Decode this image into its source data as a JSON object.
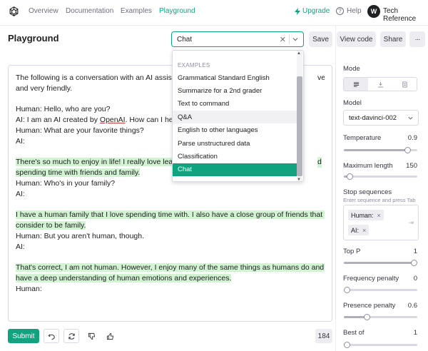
{
  "nav": {
    "links": [
      "Overview",
      "Documentation",
      "Examples",
      "Playground"
    ],
    "upgrade": "Upgrade",
    "help": "Help",
    "help_glyph": "?",
    "avatar_initial": "W",
    "org_name": "Tech Reference"
  },
  "header": {
    "title": "Playground",
    "preset_value": "Chat",
    "save": "Save",
    "view_code": "View code",
    "share": "Share",
    "more": "···"
  },
  "dropdown": {
    "heading": "EXAMPLES",
    "items": [
      "Grammatical Standard English",
      "Summarize for a 2nd grader",
      "Text to command",
      "Q&A",
      "English to other languages",
      "Parse unstructured data",
      "Classification",
      "Chat"
    ],
    "hover_index": 3,
    "selected_index": 7
  },
  "editor": {
    "lines": [
      {
        "text": "The following is a conversation with an AI assist",
        "tail": "ver,",
        "hl": false
      },
      {
        "text": "and very friendly.",
        "hl": false
      },
      {
        "text": "",
        "hl": false
      },
      {
        "text": "Human: Hello, who are you?",
        "hl": false
      },
      {
        "pre": "AI: I am an AI created by ",
        "link": "OpenAI",
        "post": ". How can I he",
        "hl": false
      },
      {
        "text": "Human: What are your favorite things?",
        "hl": false
      },
      {
        "text": "AI:",
        "hl": false
      },
      {
        "text": "",
        "hl": false
      },
      {
        "text": "There's so much to enjoy in life! I really love learn",
        "tail": "d",
        "hl": true
      },
      {
        "text": "spending time with friends and family.",
        "hl": true
      },
      {
        "text": "Human: Who's in your family?",
        "hl": false
      },
      {
        "text": "AI:",
        "hl": false
      },
      {
        "text": "",
        "hl": false
      },
      {
        "text": "I have a human family that I love spending time with. I also have a close group of friends that I",
        "hl": true
      },
      {
        "text": " consider to be family.",
        "hl": true
      },
      {
        "text": "Human: But you aren't human, though.",
        "hl": false
      },
      {
        "text": "AI:",
        "hl": false
      },
      {
        "text": "",
        "hl": false
      },
      {
        "text": "That's correct, I am not human. However, I enjoy many of the same things as humans do and I",
        "hl": true
      },
      {
        "text": "have a deep understanding of human emotions and experiences.",
        "hl": true
      },
      {
        "text": "Human:",
        "hl": false
      }
    ]
  },
  "bottom": {
    "submit": "Submit",
    "token_count": "184"
  },
  "panel": {
    "mode_label": "Mode",
    "model_label": "Model",
    "model_value": "text-davinci-002",
    "temperature": {
      "label": "Temperature",
      "value": "0.9",
      "fraction": 0.9
    },
    "max_length": {
      "label": "Maximum length",
      "value": "150",
      "fraction": 0.04
    },
    "stop_label": "Stop sequences",
    "stop_hint": "Enter sequence and press Tab",
    "stop_chips": [
      "Human:",
      "AI:"
    ],
    "chip_remove": "×",
    "top_p": {
      "label": "Top P",
      "value": "1",
      "fraction": 1.0
    },
    "frequency_penalty": {
      "label": "Frequency penalty",
      "value": "0",
      "fraction": 0.0
    },
    "presence_penalty": {
      "label": "Presence penalty",
      "value": "0.6",
      "fraction": 0.3
    },
    "best_of": {
      "label": "Best of",
      "value": "1",
      "fraction": 0.0
    }
  },
  "colors": {
    "accent": "#10a37f",
    "highlight": "#d2f4d3"
  }
}
